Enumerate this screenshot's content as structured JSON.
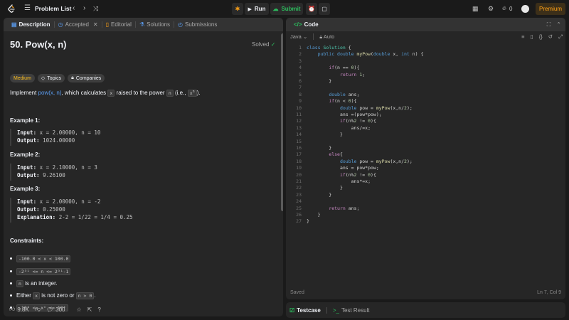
{
  "topbar": {
    "title": "Problem List",
    "run_label": "Run",
    "submit_label": "Submit",
    "streak": "0",
    "premium_label": "Premium",
    "brand_color": "#ffa116",
    "submit_color": "#2cbb5d"
  },
  "left_tabs": [
    {
      "label": "Description",
      "icon": "document-icon"
    },
    {
      "label": "Accepted",
      "icon": "history-icon"
    },
    {
      "label": "Editorial",
      "icon": "book-icon"
    },
    {
      "label": "Solutions",
      "icon": "flask-icon"
    },
    {
      "label": "Submissions",
      "icon": "clock-icon"
    }
  ],
  "problem": {
    "title": "50. Pow(x, n)",
    "status": "Solved",
    "difficulty": "Medium",
    "topics_label": "Topics",
    "companies_label": "Companies",
    "statement_prefix": "Implement ",
    "statement_link": "pow(x, n)",
    "statement_mid": ", which calculates ",
    "statement_x": "x",
    "statement_mid2": " raised to the power ",
    "statement_n": "n",
    "statement_mid3": " (i.e., ",
    "statement_xn": "x",
    "statement_xn_sup": "n",
    "statement_end": ")."
  },
  "examples": [
    {
      "heading": "Example 1:",
      "input": "x = 2.00000, n = 10",
      "output": "1024.00000"
    },
    {
      "heading": "Example 2:",
      "input": "x = 2.10000, n = 3",
      "output": "9.26100"
    },
    {
      "heading": "Example 3:",
      "input": "x = 2.00000, n = -2",
      "output": "0.25000",
      "explanation": "2-2 = 1/22 = 1/4 = 0.25"
    }
  ],
  "labels": {
    "input": "Input:",
    "output": "Output:",
    "explanation": "Explanation:",
    "constraints": "Constraints:"
  },
  "constraints": [
    {
      "code": "-100.0 < x < 100.0",
      "text": ""
    },
    {
      "code": "-2³¹ <= n <= 2³¹-1",
      "text": ""
    },
    {
      "code": "n",
      "text": " is an integer."
    },
    {
      "pre": "Either ",
      "code": "x",
      "mid": " is not zero or ",
      "code2": "n > 0",
      "text": "."
    },
    {
      "code": "-10⁴ <= xⁿ <= 10⁴",
      "text": ""
    }
  ],
  "footer": {
    "likes": "9.8K",
    "comments": "300"
  },
  "code_panel": {
    "title": "Code",
    "language": "Java",
    "mode": "Auto",
    "saved": "Saved",
    "cursor": "Ln 7, Col 9"
  },
  "code_lines": [
    "class Solution {",
    "    public double myPow(double x, int n) {",
    "",
    "        if(n == 0){",
    "            return 1;",
    "        }",
    "",
    "        double ans;",
    "        if(n < 0){",
    "            double pow = myPow(x,n/2);",
    "            ans =(pow*pow);",
    "            if(n%2 != 0){",
    "                ans/=x;",
    "            }",
    "",
    "        }",
    "        else{",
    "            double pow = myPow(x,n/2);",
    "            ans = pow*pow;",
    "            if(n%2 != 0){",
    "                ans*=x;",
    "            }",
    "        }",
    "",
    "        return ans;",
    "    }",
    "}"
  ],
  "bottom_tabs": {
    "testcase": "Testcase",
    "test_result": "Test Result"
  }
}
